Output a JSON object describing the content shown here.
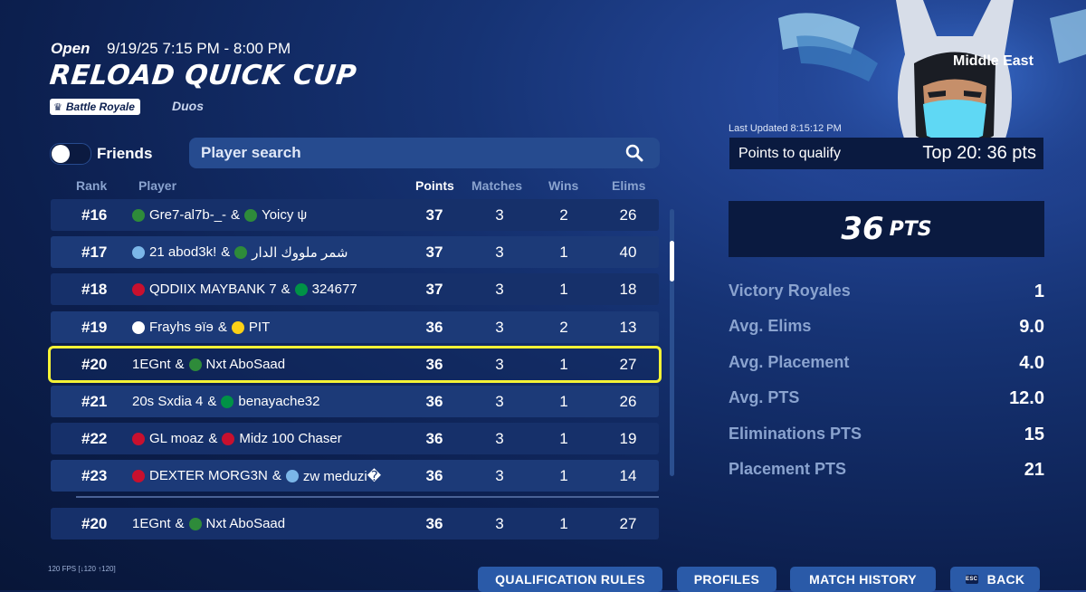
{
  "header": {
    "status": "Open",
    "time_window": "9/19/25 7:15 PM - 8:00 PM",
    "title": "RELOAD QUICK CUP",
    "mode_tag": "Battle Royale",
    "team_size": "Duos"
  },
  "filters": {
    "friends_label": "Friends",
    "friends_toggle": "off",
    "search_placeholder": "Player search"
  },
  "table": {
    "columns": {
      "rank": "Rank",
      "player": "Player",
      "points": "Points",
      "matches": "Matches",
      "wins": "Wins",
      "elims": "Elims"
    },
    "rows": [
      {
        "rank": "#16",
        "p1": "Gre7-al7b-_-",
        "p1_flag": "#2e8b3a",
        "p2": "Yoicy ψ",
        "p2_flag": "#2e8b3a",
        "points": "37",
        "matches": "3",
        "wins": "2",
        "elims": "26"
      },
      {
        "rank": "#17",
        "p1": "21 abod3k!",
        "p1_flag": "#7bb6e8",
        "p2": "شمر ملووك الدار",
        "p2_flag": "#2e8b3a",
        "points": "37",
        "matches": "3",
        "wins": "1",
        "elims": "40"
      },
      {
        "rank": "#18",
        "p1": "QDDIIX MAYBANK 7",
        "p1_flag": "#c8102e",
        "p2": "324677",
        "p2_flag": "#009246",
        "points": "37",
        "matches": "3",
        "wins": "1",
        "elims": "18"
      },
      {
        "rank": "#19",
        "p1": "Frayhs ɘïɘ",
        "p1_flag": "#ffffff",
        "p2": "PIT",
        "p2_flag": "#fcd116",
        "points": "36",
        "matches": "3",
        "wins": "2",
        "elims": "13"
      },
      {
        "rank": "#20",
        "p1": "1EGnt",
        "p1_flag": "",
        "p2": "Nxt AboSaad",
        "p2_flag": "#2e8b3a",
        "points": "36",
        "matches": "3",
        "wins": "1",
        "elims": "27"
      },
      {
        "rank": "#21",
        "p1": "20s Sxdia 4",
        "p1_flag": "",
        "p2": "benayache32",
        "p2_flag": "#009246",
        "points": "36",
        "matches": "3",
        "wins": "1",
        "elims": "26"
      },
      {
        "rank": "#22",
        "p1": "GL moaz",
        "p1_flag": "#c8102e",
        "p2": "Midz 100 Chaser",
        "p2_flag": "#c8102e",
        "points": "36",
        "matches": "3",
        "wins": "1",
        "elims": "19"
      },
      {
        "rank": "#23",
        "p1": "DEXTER MORG3N",
        "p1_flag": "#c8102e",
        "p2": "zw meduzi�",
        "p2_flag": "#7bb6e8",
        "points": "36",
        "matches": "3",
        "wins": "1",
        "elims": "14"
      }
    ],
    "highlight_index": 4,
    "self_row": {
      "rank": "#20",
      "p1": "1EGnt",
      "p2": "Nxt AboSaad",
      "p2_flag": "#2e8b3a",
      "points": "36",
      "matches": "3",
      "wins": "1",
      "elims": "27"
    },
    "joiner": "&"
  },
  "panel": {
    "region": "Middle East",
    "last_updated": "Last Updated 8:15:12 PM",
    "qualify_label": "Points to qualify",
    "qualify_value": "Top 20: 36 pts",
    "total_points": "36",
    "total_points_unit": "PTS",
    "stats": [
      {
        "label": "Victory Royales",
        "value": "1"
      },
      {
        "label": "Avg. Elims",
        "value": "9.0"
      },
      {
        "label": "Avg. Placement",
        "value": "4.0"
      },
      {
        "label": "Avg. PTS",
        "value": "12.0"
      },
      {
        "label": "Eliminations PTS",
        "value": "15"
      },
      {
        "label": "Placement PTS",
        "value": "21"
      }
    ]
  },
  "footer": {
    "fps": "120 FPS [↓120 ↑120]",
    "buttons": [
      "QUALIFICATION RULES",
      "PROFILES",
      "MATCH HISTORY",
      "BACK"
    ],
    "esc_key": "ESC"
  },
  "colors": {
    "highlight": "#f4f236",
    "accent_button": "#2a5aa8",
    "background": "#0c1f4e"
  }
}
